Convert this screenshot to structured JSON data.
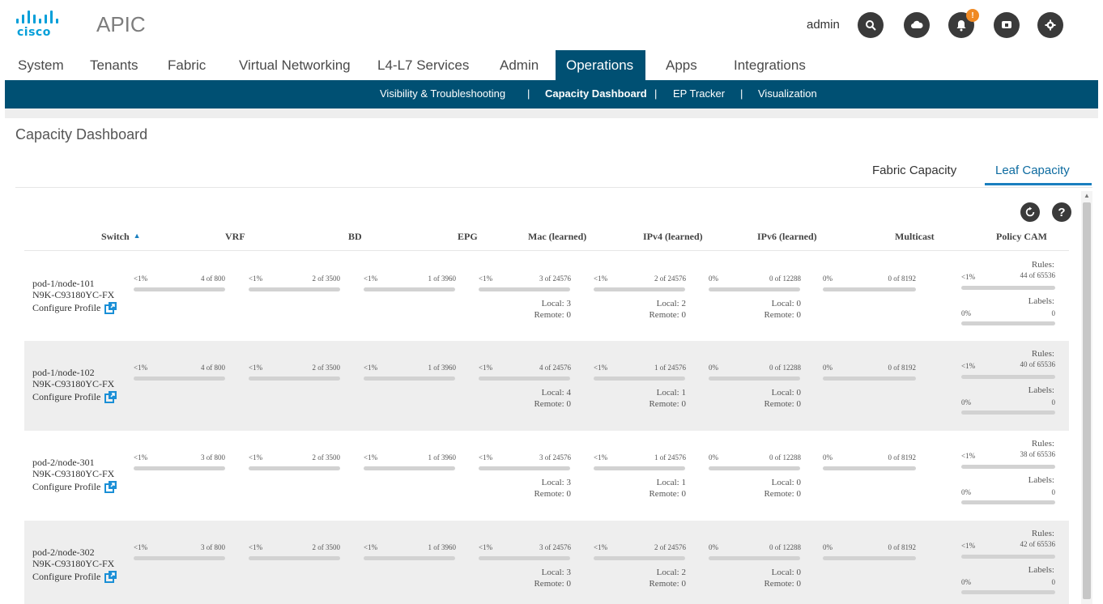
{
  "header": {
    "logo_text": "cisco",
    "app_title": "APIC",
    "user": "admin",
    "notification_count": "!"
  },
  "mainnav": [
    "System",
    "Tenants",
    "Fabric",
    "Virtual Networking",
    "L4-L7 Services",
    "Admin",
    "Operations",
    "Apps",
    "Integrations"
  ],
  "subnav": [
    "Visibility & Troubleshooting",
    "Capacity Dashboard",
    "EP Tracker",
    "Visualization"
  ],
  "subnav_sep": "|",
  "page": {
    "title": "Capacity Dashboard",
    "tab_fabric": "Fabric Capacity",
    "tab_leaf": "Leaf Capacity",
    "help": "?"
  },
  "columns": [
    "Switch",
    "VRF",
    "BD",
    "EPG",
    "Mac (learned)",
    "IPv4 (learned)",
    "IPv6 (learned)",
    "Multicast",
    "Policy CAM"
  ],
  "labels": {
    "configure": "Configure Profile",
    "rules": "Rules:",
    "labels": "Labels:"
  },
  "rows": [
    {
      "name": "pod-1/node-101",
      "model": "N9K-C93180YC-FX",
      "vrf": {
        "pct": "<1%",
        "count": "4 of 800"
      },
      "bd": {
        "pct": "<1%",
        "count": "2 of 3500"
      },
      "epg": {
        "pct": "<1%",
        "count": "1 of 3960"
      },
      "mac": {
        "pct": "<1%",
        "count": "3 of 24576",
        "local": "Local: 3",
        "remote": "Remote: 0"
      },
      "ipv4": {
        "pct": "<1%",
        "count": "2 of 24576",
        "local": "Local: 2",
        "remote": "Remote: 0"
      },
      "ipv6": {
        "pct": "0%",
        "count": "0 of 12288",
        "local": "Local: 0",
        "remote": "Remote: 0"
      },
      "mcast": {
        "pct": "0%",
        "count": "0 of 8192"
      },
      "cam": {
        "rules_pct": "<1%",
        "rules_count": "44 of 65536",
        "labels_pct": "0%",
        "labels_count": "0"
      }
    },
    {
      "name": "pod-1/node-102",
      "model": "N9K-C93180YC-FX",
      "vrf": {
        "pct": "<1%",
        "count": "4 of 800"
      },
      "bd": {
        "pct": "<1%",
        "count": "2 of 3500"
      },
      "epg": {
        "pct": "<1%",
        "count": "1 of 3960"
      },
      "mac": {
        "pct": "<1%",
        "count": "4 of 24576",
        "local": "Local: 4",
        "remote": "Remote: 0"
      },
      "ipv4": {
        "pct": "<1%",
        "count": "1 of 24576",
        "local": "Local: 1",
        "remote": "Remote: 0"
      },
      "ipv6": {
        "pct": "0%",
        "count": "0 of 12288",
        "local": "Local: 0",
        "remote": "Remote: 0"
      },
      "mcast": {
        "pct": "0%",
        "count": "0 of 8192"
      },
      "cam": {
        "rules_pct": "<1%",
        "rules_count": "40 of 65536",
        "labels_pct": "0%",
        "labels_count": "0"
      }
    },
    {
      "name": "pod-2/node-301",
      "model": "N9K-C93180YC-FX",
      "vrf": {
        "pct": "<1%",
        "count": "3 of 800"
      },
      "bd": {
        "pct": "<1%",
        "count": "2 of 3500"
      },
      "epg": {
        "pct": "<1%",
        "count": "1 of 3960"
      },
      "mac": {
        "pct": "<1%",
        "count": "3 of 24576",
        "local": "Local: 3",
        "remote": "Remote: 0"
      },
      "ipv4": {
        "pct": "<1%",
        "count": "1 of 24576",
        "local": "Local: 1",
        "remote": "Remote: 0"
      },
      "ipv6": {
        "pct": "0%",
        "count": "0 of 12288",
        "local": "Local: 0",
        "remote": "Remote: 0"
      },
      "mcast": {
        "pct": "0%",
        "count": "0 of 8192"
      },
      "cam": {
        "rules_pct": "<1%",
        "rules_count": "38 of 65536",
        "labels_pct": "0%",
        "labels_count": "0"
      }
    },
    {
      "name": "pod-2/node-302",
      "model": "N9K-C93180YC-FX",
      "vrf": {
        "pct": "<1%",
        "count": "3 of 800"
      },
      "bd": {
        "pct": "<1%",
        "count": "2 of 3500"
      },
      "epg": {
        "pct": "<1%",
        "count": "1 of 3960"
      },
      "mac": {
        "pct": "<1%",
        "count": "3 of 24576",
        "local": "Local: 3",
        "remote": "Remote: 0"
      },
      "ipv4": {
        "pct": "<1%",
        "count": "2 of 24576",
        "local": "Local: 2",
        "remote": "Remote: 0"
      },
      "ipv6": {
        "pct": "0%",
        "count": "0 of 12288",
        "local": "Local: 0",
        "remote": "Remote: 0"
      },
      "mcast": {
        "pct": "0%",
        "count": "0 of 8192"
      },
      "cam": {
        "rules_pct": "<1%",
        "rules_count": "42 of 65536",
        "labels_pct": "0%",
        "labels_count": "0"
      }
    }
  ]
}
